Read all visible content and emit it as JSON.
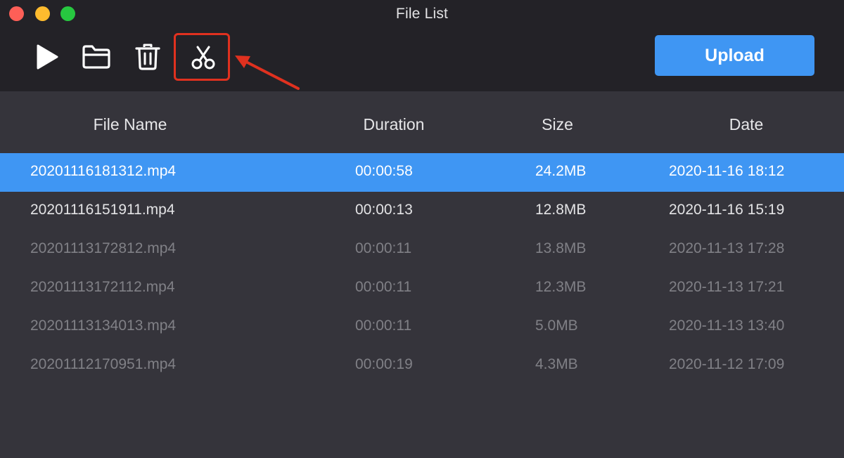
{
  "window": {
    "title": "File List"
  },
  "toolbar": {
    "icons": [
      "play-icon",
      "folder-icon",
      "trash-icon",
      "scissors-icon"
    ],
    "upload_label": "Upload"
  },
  "table": {
    "headers": {
      "name": "File Name",
      "duration": "Duration",
      "size": "Size",
      "date": "Date"
    },
    "rows": [
      {
        "name": "20201116181312.mp4",
        "duration": "00:00:58",
        "size": "24.2MB",
        "date": "2020-11-16 18:12",
        "state": "selected"
      },
      {
        "name": "20201116151911.mp4",
        "duration": "00:00:13",
        "size": "12.8MB",
        "date": "2020-11-16 15:19",
        "state": "normal"
      },
      {
        "name": "20201113172812.mp4",
        "duration": "00:00:11",
        "size": "13.8MB",
        "date": "2020-11-13 17:28",
        "state": "dim"
      },
      {
        "name": "20201113172112.mp4",
        "duration": "00:00:11",
        "size": "12.3MB",
        "date": "2020-11-13 17:21",
        "state": "dim"
      },
      {
        "name": "20201113134013.mp4",
        "duration": "00:00:11",
        "size": "5.0MB",
        "date": "2020-11-13 13:40",
        "state": "dim"
      },
      {
        "name": "20201112170951.mp4",
        "duration": "00:00:19",
        "size": "4.3MB",
        "date": "2020-11-12 17:09",
        "state": "dim"
      }
    ]
  },
  "colors": {
    "accent": "#3f96f3",
    "highlight": "#e0311f",
    "toolbar_bg": "#232227",
    "list_bg": "#35343b"
  }
}
